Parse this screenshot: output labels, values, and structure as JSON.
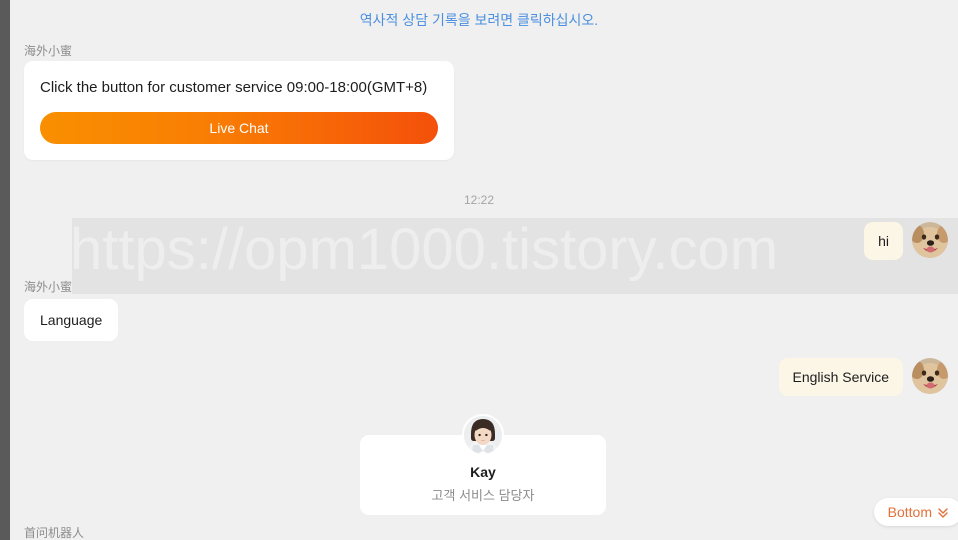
{
  "header": {
    "history_link": "역사적 상담 기록을 보려면 클릭하십시오."
  },
  "watermark": {
    "text": "https://opm1000.tistory.com"
  },
  "conversation": {
    "timestamp": "12:22",
    "bot_sender_name": "海外小蜜",
    "bot_sender_name_2": "海外小蜜",
    "bot_sender_name_3": "首问机器人",
    "card_message": "Click the button for customer service 09:00-18:00(GMT+8)",
    "live_chat_label": "Live Chat",
    "user_message_1": "hi",
    "user_message_2": "English Service",
    "bot_message_language": "Language"
  },
  "agent_card": {
    "name": "Kay",
    "role": "고객 서비스 담당자"
  },
  "bottom_button": {
    "label": "Bottom",
    "icon": "double-chevron-down-icon"
  },
  "colors": {
    "background": "#f0f0f0",
    "accent_orange_start": "#f98f00",
    "accent_orange_end": "#f4500a",
    "link_blue": "#4a8fe0",
    "user_bubble": "#fbf6e5",
    "bottom_button_text": "#e2703a",
    "left_edge": "#5b5a5a"
  }
}
